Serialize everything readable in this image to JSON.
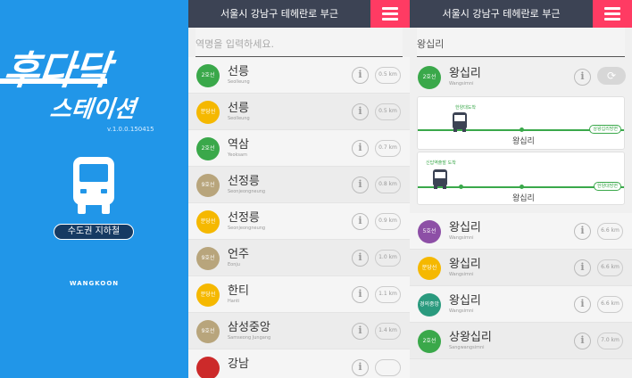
{
  "splash": {
    "logo_line1": "후다닥",
    "logo_line2": "스테이션",
    "version": "v.1.0.0.150415",
    "button_label": "수도권 지하철",
    "brand": "WANGKOON"
  },
  "search_panel": {
    "header_title": "서울시 강남구 테헤란로 부근",
    "search_placeholder": "역명을 입력하세요.",
    "stations": [
      {
        "line": "2호선",
        "color": "#3aa84a",
        "name": "선릉",
        "roman": "Seolleung",
        "dist": "0.5 km"
      },
      {
        "line": "분당선",
        "color": "#f5b800",
        "name": "선릉",
        "roman": "Seolleung",
        "dist": "0.5 km"
      },
      {
        "line": "2호선",
        "color": "#3aa84a",
        "name": "역삼",
        "roman": "Yeoksam",
        "dist": "0.7 km"
      },
      {
        "line": "9호선",
        "color": "#b8a57c",
        "name": "선정릉",
        "roman": "Seonjeongneung",
        "dist": "0.8 km"
      },
      {
        "line": "분당선",
        "color": "#f5b800",
        "name": "선정릉",
        "roman": "Seonjeongneung",
        "dist": "0.9 km"
      },
      {
        "line": "9호선",
        "color": "#b8a57c",
        "name": "언주",
        "roman": "Eonju",
        "dist": "1.0 km"
      },
      {
        "line": "분당선",
        "color": "#f5b800",
        "name": "한티",
        "roman": "Hanti",
        "dist": "1.1 km"
      },
      {
        "line": "9호선",
        "color": "#b8a57c",
        "name": "삼성중앙",
        "roman": "Samseong Jungang",
        "dist": "1.4 km"
      },
      {
        "line": "",
        "color": "#cc2a2a",
        "name": "강남",
        "roman": "",
        "dist": ""
      }
    ]
  },
  "detail_panel": {
    "header_title": "서울시 강남구 테헤란로 부근",
    "section_title": "왕십리",
    "current": {
      "line": "2호선",
      "color": "#3aa84a",
      "name": "왕십리",
      "roman": "Wangsimni",
      "refresh_icon": "refresh-icon"
    },
    "card1": {
      "bus_label": "한양대도착",
      "station": "왕십리",
      "bound": "상왕십리방면"
    },
    "card2": {
      "bus_label": "신답역출발 도착",
      "station": "왕십리",
      "bound": "한양대방면"
    },
    "others": [
      {
        "line": "5호선",
        "color": "#8d4fa6",
        "name": "왕십리",
        "roman": "Wangsimni",
        "dist": "6.6 km"
      },
      {
        "line": "분당선",
        "color": "#f5b800",
        "name": "왕십리",
        "roman": "Wangsimni",
        "dist": "6.6 km"
      },
      {
        "line": "경의중앙선",
        "color": "#2a9a7e",
        "name": "왕십리",
        "roman": "Wangsimni",
        "dist": "6.6 km"
      },
      {
        "line": "2호선",
        "color": "#3aa84a",
        "name": "상왕십리",
        "roman": "Sangwangsimni",
        "dist": "7.0 km"
      }
    ]
  },
  "icons": {
    "info": "i",
    "menu": "menu-icon",
    "bus": "bus-icon"
  }
}
